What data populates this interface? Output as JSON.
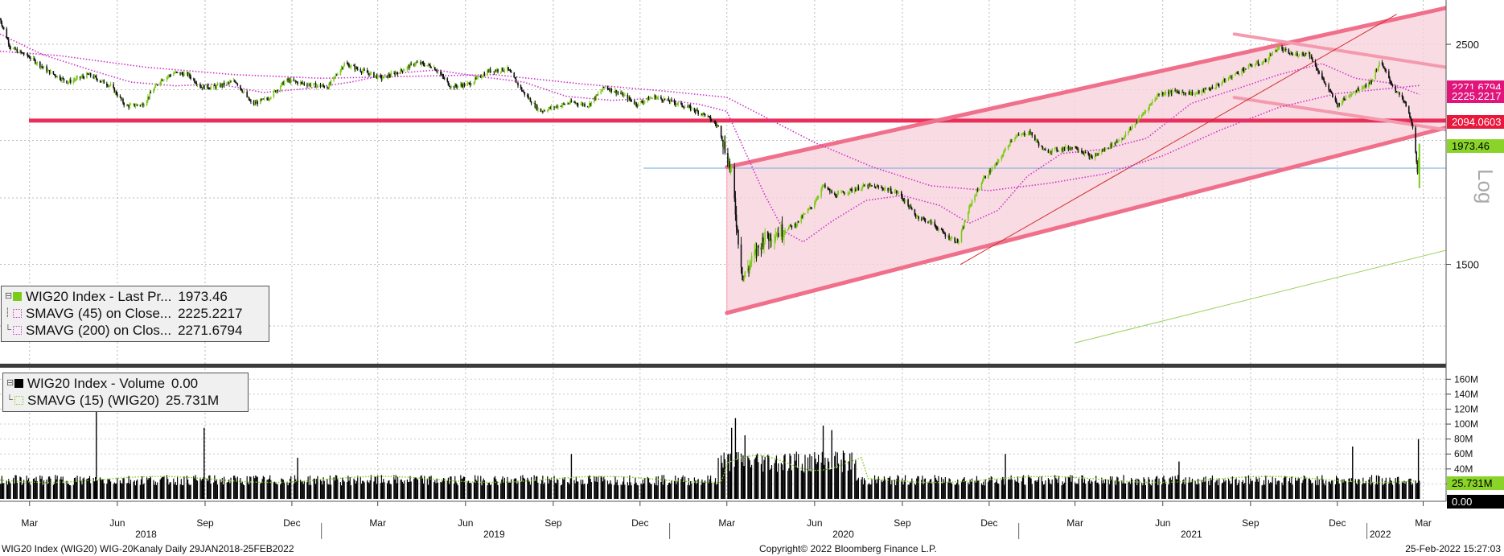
{
  "chart_data": {
    "type": "line",
    "title": "",
    "scale": "log",
    "price_axis": {
      "ticks": [
        1500,
        2500
      ],
      "tick_labels": [
        "1500",
        "2500"
      ],
      "ylim": [
        1200,
        2750
      ],
      "side_label": "Log"
    },
    "volume_axis": {
      "ticks": [
        20,
        40,
        60,
        80,
        100,
        120,
        140,
        160
      ],
      "tick_labels": [
        "20M",
        "40M",
        "60M",
        "80M",
        "100M",
        "120M",
        "140M",
        "160M"
      ],
      "ylim": [
        0,
        170
      ]
    },
    "x_axis": {
      "month_ticks": [
        {
          "date": "2018-03-01",
          "label": "Mar"
        },
        {
          "date": "2018-06-01",
          "label": "Jun"
        },
        {
          "date": "2018-09-01",
          "label": "Sep"
        },
        {
          "date": "2018-12-01",
          "label": "Dec"
        },
        {
          "date": "2019-03-01",
          "label": "Mar"
        },
        {
          "date": "2019-06-01",
          "label": "Jun"
        },
        {
          "date": "2019-09-01",
          "label": "Sep"
        },
        {
          "date": "2019-12-01",
          "label": "Dec"
        },
        {
          "date": "2020-03-01",
          "label": "Mar"
        },
        {
          "date": "2020-06-01",
          "label": "Jun"
        },
        {
          "date": "2020-09-01",
          "label": "Sep"
        },
        {
          "date": "2020-12-01",
          "label": "Dec"
        },
        {
          "date": "2021-03-01",
          "label": "Mar"
        },
        {
          "date": "2021-06-01",
          "label": "Jun"
        },
        {
          "date": "2021-09-01",
          "label": "Sep"
        },
        {
          "date": "2021-12-01",
          "label": "Dec"
        },
        {
          "date": "2022-03-01",
          "label": "Mar"
        }
      ],
      "year_labels": [
        {
          "date": "2018-07-01",
          "label": "2018"
        },
        {
          "date": "2019-07-01",
          "label": "2019"
        },
        {
          "date": "2020-07-01",
          "label": "2020"
        },
        {
          "date": "2021-07-01",
          "label": "2021"
        },
        {
          "date": "2022-01-15",
          "label": "2022"
        }
      ],
      "year_boundaries": [
        "2019-01-01",
        "2020-01-01",
        "2021-01-01",
        "2022-01-01"
      ],
      "xlim": [
        "2018-01-29",
        "2022-03-25"
      ]
    },
    "series": [
      {
        "name": "WIG20 Index - Last Pr...",
        "kind": "price",
        "color": "#7CCB1A",
        "last": "1973.46",
        "points": [
          [
            "2018-01-29",
            2650
          ],
          [
            "2018-02-09",
            2480
          ],
          [
            "2018-02-28",
            2430
          ],
          [
            "2018-03-20",
            2350
          ],
          [
            "2018-04-10",
            2290
          ],
          [
            "2018-05-02",
            2330
          ],
          [
            "2018-05-25",
            2270
          ],
          [
            "2018-06-10",
            2165
          ],
          [
            "2018-06-28",
            2175
          ],
          [
            "2018-07-16",
            2300
          ],
          [
            "2018-07-31",
            2340
          ],
          [
            "2018-08-14",
            2330
          ],
          [
            "2018-08-28",
            2265
          ],
          [
            "2018-09-12",
            2265
          ],
          [
            "2018-10-03",
            2295
          ],
          [
            "2018-10-20",
            2175
          ],
          [
            "2018-11-06",
            2205
          ],
          [
            "2018-11-25",
            2300
          ],
          [
            "2018-12-15",
            2280
          ],
          [
            "2019-01-08",
            2265
          ],
          [
            "2019-01-25",
            2390
          ],
          [
            "2019-02-13",
            2350
          ],
          [
            "2019-03-05",
            2310
          ],
          [
            "2019-03-25",
            2350
          ],
          [
            "2019-04-10",
            2395
          ],
          [
            "2019-04-28",
            2375
          ],
          [
            "2019-05-17",
            2265
          ],
          [
            "2019-06-05",
            2280
          ],
          [
            "2019-06-25",
            2350
          ],
          [
            "2019-07-15",
            2360
          ],
          [
            "2019-07-31",
            2240
          ],
          [
            "2019-08-18",
            2140
          ],
          [
            "2019-09-05",
            2165
          ],
          [
            "2019-09-20",
            2185
          ],
          [
            "2019-10-08",
            2170
          ],
          [
            "2019-10-25",
            2265
          ],
          [
            "2019-11-10",
            2230
          ],
          [
            "2019-11-28",
            2175
          ],
          [
            "2019-12-15",
            2215
          ],
          [
            "2020-01-05",
            2185
          ],
          [
            "2020-01-20",
            2160
          ],
          [
            "2020-02-08",
            2120
          ],
          [
            "2020-02-22",
            2060
          ],
          [
            "2020-03-06",
            1850
          ],
          [
            "2020-03-12",
            1620
          ],
          [
            "2020-03-18",
            1450
          ],
          [
            "2020-03-25",
            1500
          ],
          [
            "2020-04-08",
            1590
          ],
          [
            "2020-04-25",
            1620
          ],
          [
            "2020-05-12",
            1645
          ],
          [
            "2020-05-30",
            1720
          ],
          [
            "2020-06-10",
            1800
          ],
          [
            "2020-06-22",
            1760
          ],
          [
            "2020-07-08",
            1780
          ],
          [
            "2020-07-25",
            1800
          ],
          [
            "2020-08-12",
            1790
          ],
          [
            "2020-08-28",
            1770
          ],
          [
            "2020-09-15",
            1680
          ],
          [
            "2020-10-02",
            1650
          ],
          [
            "2020-10-18",
            1600
          ],
          [
            "2020-10-30",
            1580
          ],
          [
            "2020-11-12",
            1730
          ],
          [
            "2020-11-25",
            1830
          ],
          [
            "2020-12-10",
            1900
          ],
          [
            "2020-12-25",
            2010
          ],
          [
            "2021-01-12",
            2040
          ],
          [
            "2021-01-28",
            1950
          ],
          [
            "2021-02-14",
            1960
          ],
          [
            "2021-03-02",
            1970
          ],
          [
            "2021-03-18",
            1920
          ],
          [
            "2021-04-05",
            1970
          ],
          [
            "2021-04-22",
            2020
          ],
          [
            "2021-05-10",
            2120
          ],
          [
            "2021-05-28",
            2230
          ],
          [
            "2021-06-15",
            2240
          ],
          [
            "2021-07-05",
            2230
          ],
          [
            "2021-07-25",
            2265
          ],
          [
            "2021-08-15",
            2330
          ],
          [
            "2021-09-01",
            2380
          ],
          [
            "2021-09-15",
            2400
          ],
          [
            "2021-09-30",
            2480
          ],
          [
            "2021-10-15",
            2440
          ],
          [
            "2021-11-01",
            2450
          ],
          [
            "2021-11-15",
            2310
          ],
          [
            "2021-12-01",
            2170
          ],
          [
            "2021-12-15",
            2230
          ],
          [
            "2022-01-05",
            2290
          ],
          [
            "2022-01-15",
            2400
          ],
          [
            "2022-01-28",
            2270
          ],
          [
            "2022-02-10",
            2180
          ],
          [
            "2022-02-18",
            2070
          ],
          [
            "2022-02-23",
            1850
          ],
          [
            "2022-02-25",
            1973.46
          ]
        ]
      },
      {
        "name": "SMAVG (45)  on Close...",
        "kind": "sma",
        "color": "#CC33CC",
        "last": "2225.2217",
        "points": [
          [
            "2018-01-29",
            2560
          ],
          [
            "2018-03-15",
            2440
          ],
          [
            "2018-05-01",
            2360
          ],
          [
            "2018-06-15",
            2290
          ],
          [
            "2018-08-01",
            2270
          ],
          [
            "2018-09-15",
            2280
          ],
          [
            "2018-11-01",
            2235
          ],
          [
            "2018-12-15",
            2255
          ],
          [
            "2019-02-01",
            2290
          ],
          [
            "2019-03-15",
            2335
          ],
          [
            "2019-05-01",
            2355
          ],
          [
            "2019-06-15",
            2320
          ],
          [
            "2019-08-01",
            2290
          ],
          [
            "2019-09-15",
            2215
          ],
          [
            "2019-11-01",
            2195
          ],
          [
            "2019-12-15",
            2205
          ],
          [
            "2020-02-01",
            2175
          ],
          [
            "2020-03-01",
            2140
          ],
          [
            "2020-03-20",
            1950
          ],
          [
            "2020-04-10",
            1760
          ],
          [
            "2020-04-30",
            1620
          ],
          [
            "2020-05-20",
            1580
          ],
          [
            "2020-06-20",
            1660
          ],
          [
            "2020-07-25",
            1740
          ],
          [
            "2020-09-01",
            1760
          ],
          [
            "2020-10-10",
            1720
          ],
          [
            "2020-11-10",
            1650
          ],
          [
            "2020-12-10",
            1700
          ],
          [
            "2021-01-10",
            1840
          ],
          [
            "2021-02-15",
            1940
          ],
          [
            "2021-04-01",
            1960
          ],
          [
            "2021-05-15",
            2010
          ],
          [
            "2021-07-01",
            2180
          ],
          [
            "2021-08-15",
            2250
          ],
          [
            "2021-10-01",
            2330
          ],
          [
            "2021-11-15",
            2390
          ],
          [
            "2021-12-20",
            2310
          ],
          [
            "2022-01-25",
            2285
          ],
          [
            "2022-02-25",
            2225.2217
          ]
        ]
      },
      {
        "name": "SMAVG (200)  on Clos...",
        "kind": "sma",
        "color": "#CC33CC",
        "last": "2271.6794",
        "points": [
          [
            "2018-01-29",
            2460
          ],
          [
            "2018-04-01",
            2435
          ],
          [
            "2018-07-01",
            2370
          ],
          [
            "2018-10-01",
            2330
          ],
          [
            "2019-01-01",
            2310
          ],
          [
            "2019-04-01",
            2320
          ],
          [
            "2019-07-01",
            2330
          ],
          [
            "2019-10-01",
            2280
          ],
          [
            "2020-01-01",
            2240
          ],
          [
            "2020-03-01",
            2210
          ],
          [
            "2020-04-15",
            2100
          ],
          [
            "2020-06-01",
            1990
          ],
          [
            "2020-08-01",
            1880
          ],
          [
            "2020-10-01",
            1800
          ],
          [
            "2020-12-01",
            1780
          ],
          [
            "2021-02-01",
            1810
          ],
          [
            "2021-04-01",
            1850
          ],
          [
            "2021-06-01",
            1930
          ],
          [
            "2021-08-01",
            2050
          ],
          [
            "2021-10-01",
            2160
          ],
          [
            "2021-12-01",
            2230
          ],
          [
            "2022-02-25",
            2271.6794
          ]
        ]
      }
    ],
    "reference_lines": [
      {
        "kind": "horizontal",
        "value": 2094.0603,
        "label": "2094.0603",
        "color": "#E8305A"
      },
      {
        "kind": "horizontal",
        "value": 1875,
        "label": "",
        "color": "#6FA8DC"
      }
    ],
    "trend_lines": [
      {
        "name": "channel-upper",
        "from": [
          "2020-03-01",
          1880
        ],
        "to": [
          "2022-03-25",
          2720
        ],
        "color": "#F0708C"
      },
      {
        "name": "channel-lower",
        "from": [
          "2020-03-01",
          1340
        ],
        "to": [
          "2022-03-25",
          2060
        ],
        "color": "#F0708C"
      },
      {
        "name": "inner-upper",
        "from": [
          "2021-08-15",
          2560
        ],
        "to": [
          "2022-03-25",
          2370
        ],
        "color": "#F39AAE"
      },
      {
        "name": "inner-lower",
        "from": [
          "2021-08-15",
          2210
        ],
        "to": [
          "2022-03-25",
          2050
        ],
        "color": "#F39AAE"
      },
      {
        "name": "thin-red",
        "from": [
          "2020-11-01",
          1500
        ],
        "to": [
          "2022-02-01",
          2680
        ],
        "color": "#D22C2C"
      },
      {
        "name": "green-support",
        "from": [
          "2021-03-01",
          1250
        ],
        "to": [
          "2022-03-25",
          1550
        ],
        "color": "#9BD25A"
      }
    ],
    "volume_series": [
      {
        "name": "WIG20 Index - Volume",
        "color": "#000000",
        "last": "0.00",
        "spikes": [
          [
            "2018-05-10",
            140
          ],
          [
            "2018-08-31",
            95
          ],
          [
            "2018-12-07",
            55
          ],
          [
            "2019-09-20",
            60
          ],
          [
            "2020-03-06",
            95
          ],
          [
            "2020-03-10",
            108
          ],
          [
            "2020-03-20",
            85
          ],
          [
            "2020-06-10",
            98
          ],
          [
            "2020-06-19",
            92
          ],
          [
            "2020-12-18",
            60
          ],
          [
            "2021-06-18",
            50
          ],
          [
            "2021-12-17",
            70
          ],
          [
            "2022-02-24",
            80
          ]
        ]
      },
      {
        "name": "SMAVG (15) (WIG20)",
        "color": "#7CCB1A",
        "last": "25.731M"
      }
    ]
  },
  "legend_price": {
    "rows": [
      {
        "label": "WIG20 Index - Last Pr...",
        "value": "1973.46"
      },
      {
        "label": "SMAVG (45)  on Close...",
        "value": "2225.2217"
      },
      {
        "label": "SMAVG (200)  on Clos...",
        "value": "2271.6794"
      }
    ]
  },
  "legend_volume": {
    "rows": [
      {
        "label": "WIG20 Index - Volume",
        "value": "0.00"
      },
      {
        "label": "SMAVG (15) (WIG20)",
        "value": "25.731M"
      }
    ]
  },
  "axis_tags": {
    "sma200": "2271.6794",
    "sma45": "2225.2217",
    "hline": "2094.0603",
    "last": "1973.46",
    "vol_sma": "25.731M",
    "vol_last": "0.00"
  },
  "footer": {
    "left": "WIG20 Index (WIG20) WIG-20Kanaly  Daily 29JAN2018-25FEB2022",
    "center": "Copyright© 2022 Bloomberg Finance L.P.",
    "right": "25-Feb-2022 15:27:03"
  },
  "colors": {
    "up": "#7CCB1A",
    "down": "#111111",
    "sma": "#CC33CC",
    "channel_fill": "#F8D3DC",
    "channel_line": "#F0708C",
    "hline": "#E8305A",
    "tag_magenta": "#E0147A",
    "tag_red": "#E8183C",
    "tag_green": "#8AD42A"
  }
}
